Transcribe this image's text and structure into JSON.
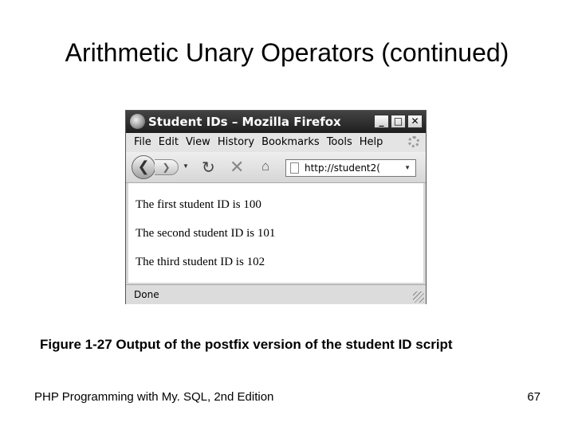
{
  "slide": {
    "title": "Arithmetic Unary Operators (continued)",
    "caption": "Figure 1-27 Output of the postfix version of the student ID script",
    "footer_left": "PHP Programming with My. SQL, 2nd Edition",
    "page_number": "67"
  },
  "browser": {
    "window_title": "Student IDs – Mozilla Firefox",
    "window_buttons": {
      "minimize": "_",
      "maximize": "□",
      "close": "✕"
    },
    "menu": [
      "File",
      "Edit",
      "View",
      "History",
      "Bookmarks",
      "Tools",
      "Help"
    ],
    "address": "http://student2(",
    "content_lines": [
      "The first student ID is 100",
      "The second student ID is 101",
      "The third student ID is 102"
    ],
    "status": "Done",
    "icons": {
      "back": "❮",
      "forward": "❯",
      "dropdown": "▼",
      "reload": "↻",
      "stop": "✕",
      "home": "⌂",
      "url_dropdown": "▼"
    }
  }
}
